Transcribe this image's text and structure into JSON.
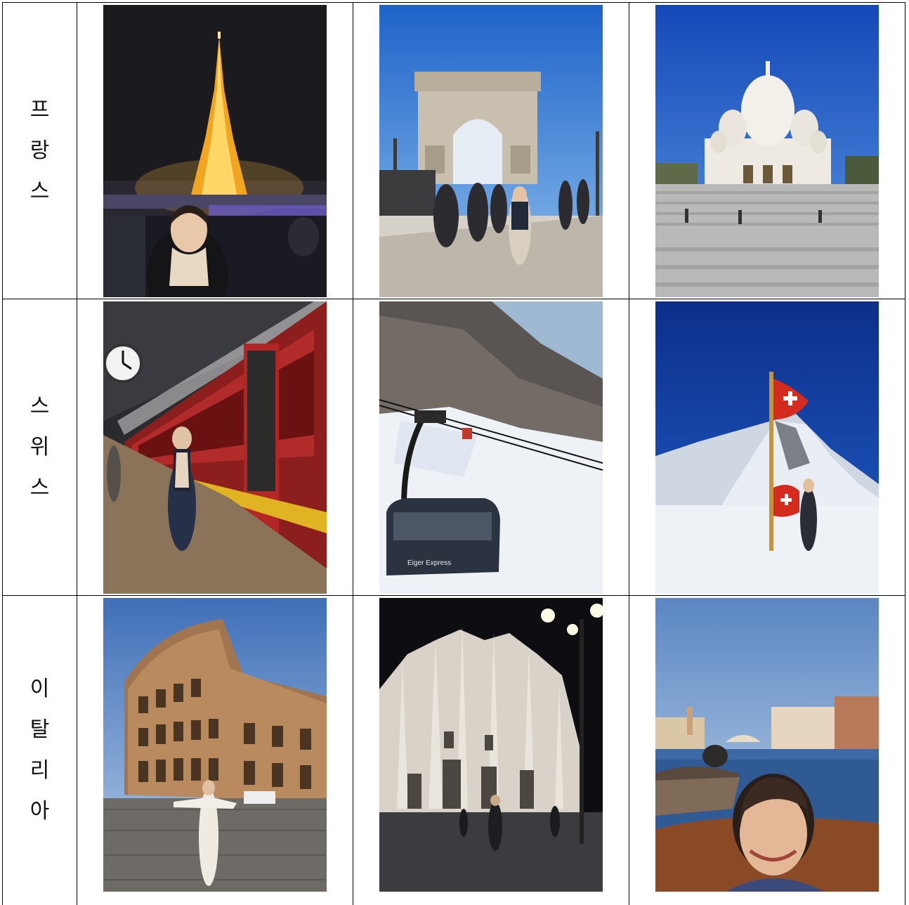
{
  "rows": [
    {
      "country": [
        "프",
        "랑",
        "스"
      ],
      "photos": [
        {
          "icon": "eiffel-tower-night-photo"
        },
        {
          "icon": "arc-de-triomphe-photo"
        },
        {
          "icon": "sacre-coeur-photo"
        }
      ]
    },
    {
      "country": [
        "스",
        "위",
        "스"
      ],
      "photos": [
        {
          "icon": "red-train-platform-photo"
        },
        {
          "icon": "cable-car-mountain-photo",
          "cabin_text": "Eiger Express"
        },
        {
          "icon": "swiss-flag-snow-photo"
        }
      ]
    },
    {
      "country": [
        "이",
        "탈",
        "리",
        "아"
      ],
      "photos": [
        {
          "icon": "colosseum-photo"
        },
        {
          "icon": "milan-cathedral-night-photo"
        },
        {
          "icon": "venice-canal-selfie-photo"
        }
      ]
    }
  ],
  "colors": {
    "border": "#000000",
    "night_sky": "#1b1b1f",
    "blue_sky": "#2f6fd0",
    "snow": "#eef2f7",
    "swiss_red": "#d52b1e"
  }
}
